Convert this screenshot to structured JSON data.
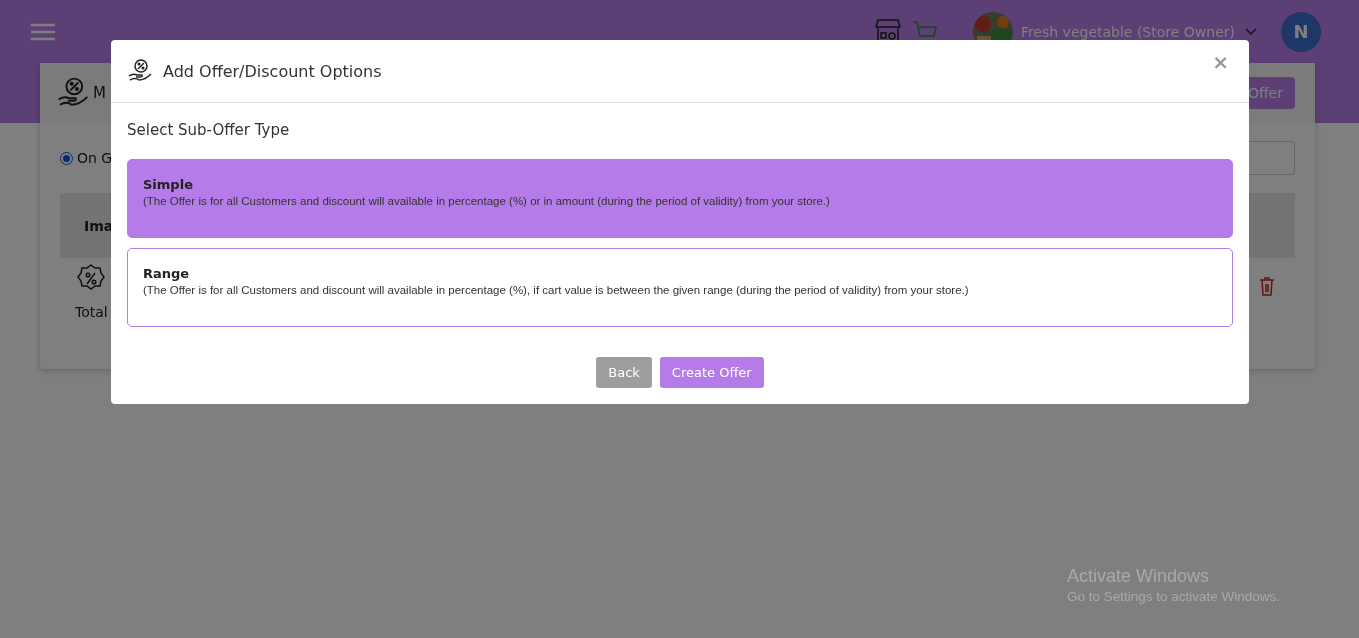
{
  "header": {
    "store_name": "Fresh vegetable (Store Owner)",
    "avatar_initial": "N"
  },
  "page": {
    "card_title": "M",
    "add_button": "Offer",
    "filter_radio": {
      "label": "On G",
      "selected": true
    },
    "table_header": "Ima",
    "total_label": "Total"
  },
  "modal": {
    "title": "Add Offer/Discount Options",
    "close": "×",
    "prompt": "Select Sub-Offer Type",
    "options": [
      {
        "title": "Simple",
        "description": "(The Offer is for all Customers and discount will available in percentage (%) or in amount (during the period of validity) from your store.)",
        "selected": true
      },
      {
        "title": "Range",
        "description": "(The Offer is for all Customers and discount will available in percentage (%), if cart value is between the given range (during the period of validity) from your store.)",
        "selected": false
      }
    ],
    "buttons": [
      {
        "label": "Back",
        "kind": "secondary"
      },
      {
        "label": "Create Offer",
        "kind": "primary"
      }
    ]
  },
  "os_notice": {
    "title": "Activate Windows",
    "subtitle": "Go to Settings to activate Windows."
  }
}
